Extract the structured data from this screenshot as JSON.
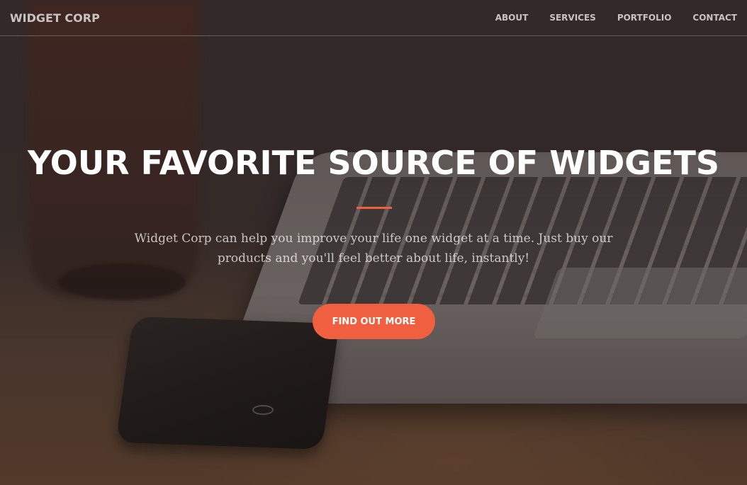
{
  "navbar": {
    "brand": "WIDGET CORP",
    "links": [
      {
        "label": "ABOUT"
      },
      {
        "label": "SERVICES"
      },
      {
        "label": "PORTFOLIO"
      },
      {
        "label": "CONTACT"
      }
    ]
  },
  "hero": {
    "headline": "YOUR FAVORITE SOURCE OF WIDGETS",
    "subtext": "Widget Corp can help you improve your life one widget at a time. Just buy our products and you'll feel better about life, instantly!",
    "cta_label": "FIND OUT MORE"
  },
  "colors": {
    "accent": "#f05f40",
    "overlay": "#3c3231",
    "text": "#ffffff"
  }
}
